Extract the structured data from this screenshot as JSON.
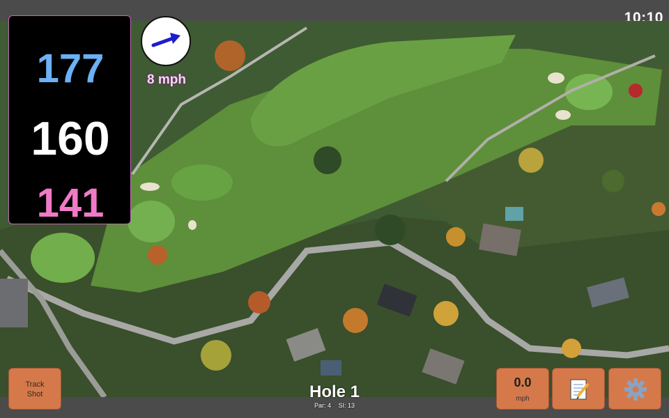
{
  "status_bar": {
    "time": "10:10"
  },
  "yardage": {
    "back": "177",
    "middle": "160",
    "front": "141"
  },
  "wind": {
    "speed_label": "8 mph",
    "icon": "arrow-right-up-icon"
  },
  "hole": {
    "title": "Hole 1",
    "par": "Par: 4",
    "stroke_index": "SI: 13"
  },
  "buttons": {
    "track_shot": {
      "line1": "Track",
      "line2": "Shot"
    },
    "speed": {
      "value": "0.0",
      "unit": "mph"
    },
    "notes": {
      "icon": "notepad-icon"
    },
    "settings": {
      "icon": "gear-icon"
    }
  },
  "colors": {
    "back_yardage": "#6cb0f5",
    "middle_yardage": "#ffffff",
    "front_yardage": "#f07ac7",
    "button_bg": "#d5794a"
  }
}
